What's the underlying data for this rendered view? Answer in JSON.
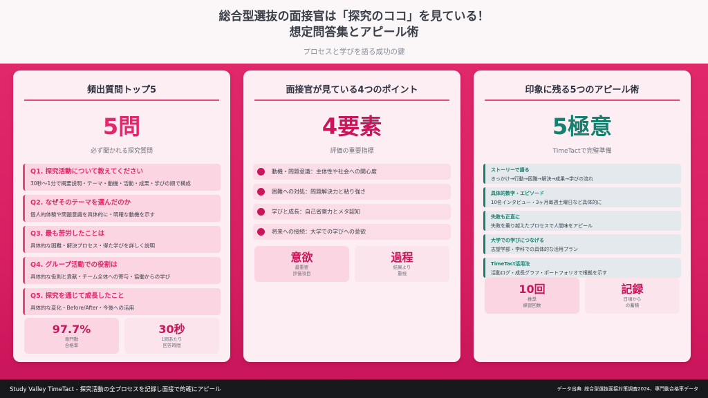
{
  "header": {
    "title_line1": "総合型選抜の面接官は「探究のココ」を見ている！",
    "title_line2": "想定問答集とアピール術",
    "subtitle": "プロセスと学びを語る成功の鍵"
  },
  "cards": {
    "questions": {
      "title": "頻出質問トップ5",
      "big": "5問",
      "caption": "必ず聞かれる探究質問",
      "items": [
        {
          "head": "Q1. 探究活動について教えてください",
          "desc": "30秒〜1分で概要説明・テーマ・動機・活動・成果・学びの順で構成"
        },
        {
          "head": "Q2. なぜそのテーマを選んだのか",
          "desc": "個人的体験や問題意識を具体的に・明確な動機を示す"
        },
        {
          "head": "Q3. 最も苦労したことは",
          "desc": "具体的な困難・解決プロセス・得た学びを詳しく説明"
        },
        {
          "head": "Q4. グループ活動での役割は",
          "desc": "具体的な役割と貢献・チーム全体への寄与・協働からの学び"
        },
        {
          "head": "Q5. 探究を通じて成長したこと",
          "desc": "具体的な変化・Before/After・今後への活用"
        }
      ],
      "stats": [
        {
          "value": "97.7%",
          "line1": "専門動",
          "line2": "合格率"
        },
        {
          "value": "30秒",
          "line1": "1問あたり",
          "line2": "回答時間"
        }
      ]
    },
    "points": {
      "title": "面接官が見ている4つのポイント",
      "big": "4要素",
      "caption": "評価の重要指標",
      "items": [
        "動機・問題意識：主体性や社会への関心度",
        "困難への対処：問題解決力と粘り強さ",
        "学びと成長：自己省察力とメタ認知",
        "将来への接続：大学での学びへの意欲"
      ],
      "stats": [
        {
          "value": "意欲",
          "line1": "最重要",
          "line2": "評価項目"
        },
        {
          "value": "過程",
          "line1": "結果より",
          "line2": "重視"
        }
      ]
    },
    "appeal": {
      "title": "印象に残る5つのアピール術",
      "big": "5極意",
      "caption": "TimeTactで完璧準備",
      "items": [
        {
          "head": "ストーリーで語る",
          "desc": "きっかけ→行動→困難→解決→成果→学びの流れ"
        },
        {
          "head": "具体的数字・エピソード",
          "desc": "10名インタビュー・3ヶ月毎週土曜日など具体的に"
        },
        {
          "head": "失敗も正直に",
          "desc": "失敗を乗り越えたプロセスで人間味をアピール"
        },
        {
          "head": "大学での学びにつなげる",
          "desc": "志望学部・学科での具体的な活用プラン"
        },
        {
          "head": "TimeTact活用法",
          "desc": "活動ログ・成長グラフ・ポートフォリオで根拠を示す"
        }
      ],
      "stats": [
        {
          "value": "10回",
          "line1": "推奨",
          "line2": "練習回数"
        },
        {
          "value": "記録",
          "line1": "日頃から",
          "line2": "の蓄積"
        }
      ]
    }
  },
  "footer": {
    "left": "Study Valley TimeTact - 探究活動の全プロセスを記録し面接で的確にアピール",
    "right": "データ出典: 総合型選抜面接対策調査2024、専門動合格率データ"
  },
  "colors": {
    "pink": "#e0286a",
    "crimson": "#c9155a",
    "teal": "#15806e"
  }
}
